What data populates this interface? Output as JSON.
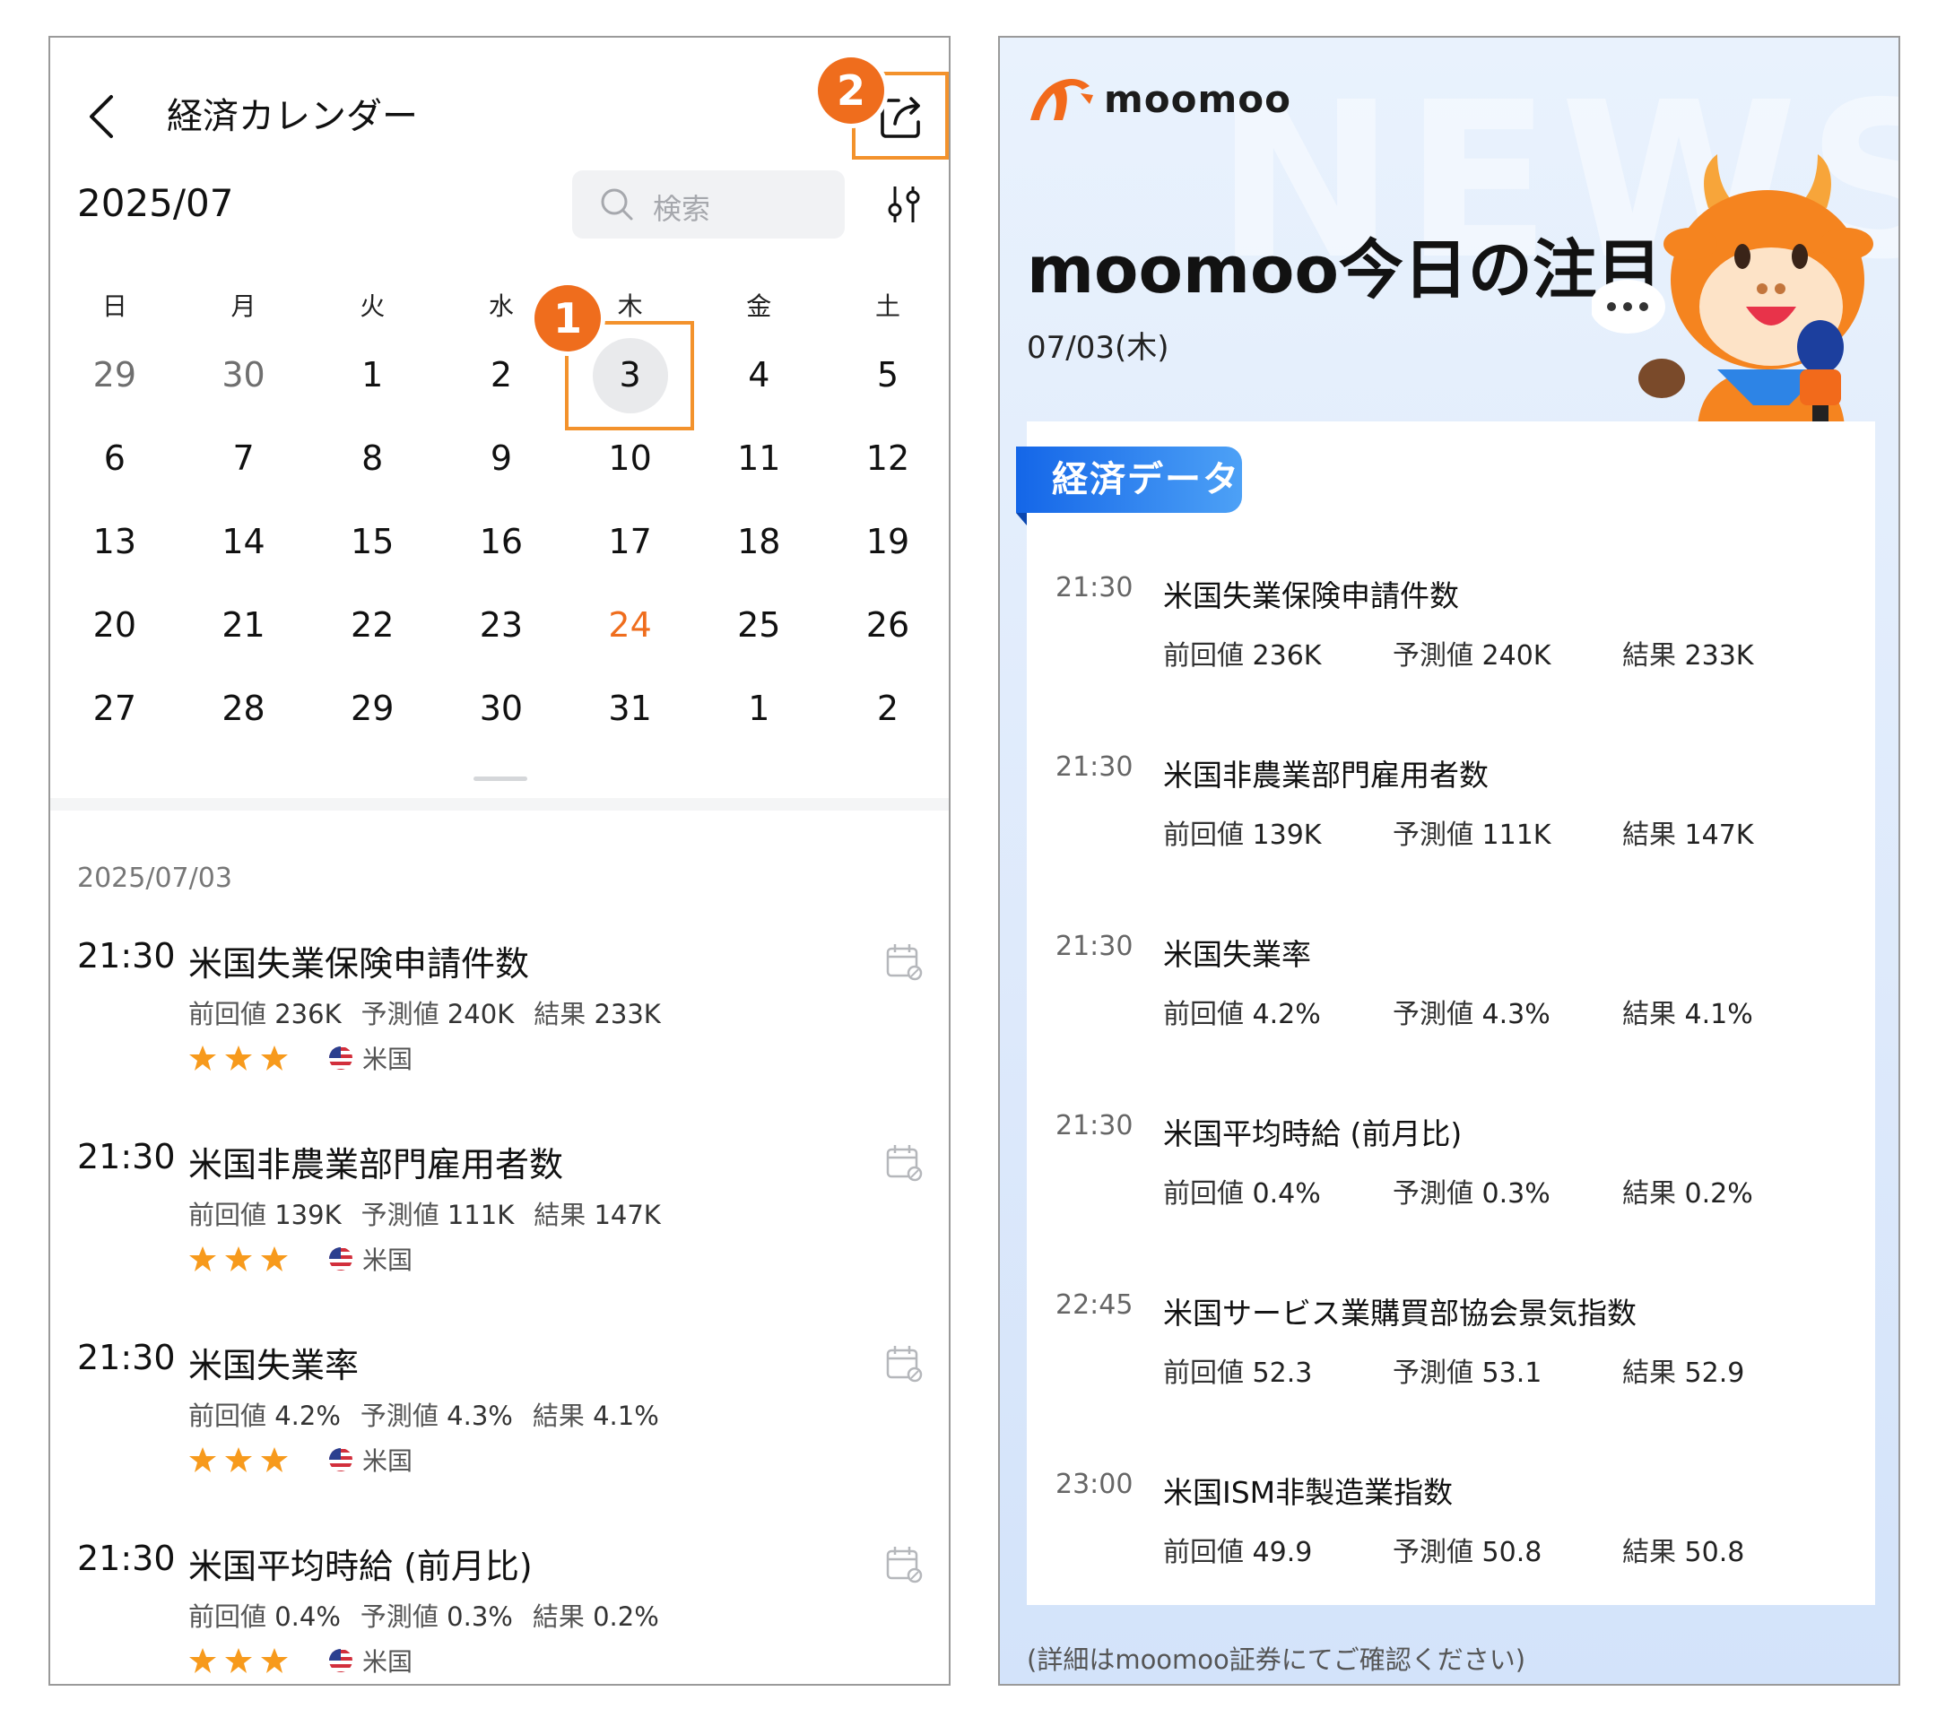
{
  "left": {
    "header": {
      "title": "経済カレンダー"
    },
    "badges": {
      "one": "1",
      "two": "2"
    },
    "month": "2025/07",
    "search": {
      "placeholder": "検索"
    },
    "weekdays": [
      "日",
      "月",
      "火",
      "水",
      "木",
      "金",
      "土"
    ],
    "weeks": [
      [
        "29",
        "30",
        "1",
        "2",
        "3",
        "4",
        "5"
      ],
      [
        "6",
        "7",
        "8",
        "9",
        "10",
        "11",
        "12"
      ],
      [
        "13",
        "14",
        "15",
        "16",
        "17",
        "18",
        "19"
      ],
      [
        "20",
        "21",
        "22",
        "23",
        "24",
        "25",
        "26"
      ],
      [
        "27",
        "28",
        "29",
        "30",
        "31",
        "1",
        "2"
      ]
    ],
    "list_date": "2025/07/03",
    "events": [
      {
        "time": "21:30",
        "name": "米国失業保険申請件数",
        "prev_label": "前回値",
        "prev": "236K",
        "fc_label": "予測値",
        "fc": "240K",
        "res_label": "結果",
        "res": "233K",
        "country": "米国"
      },
      {
        "time": "21:30",
        "name": "米国非農業部門雇用者数",
        "prev_label": "前回値",
        "prev": "139K",
        "fc_label": "予測値",
        "fc": "111K",
        "res_label": "結果",
        "res": "147K",
        "country": "米国"
      },
      {
        "time": "21:30",
        "name": "米国失業率",
        "prev_label": "前回値",
        "prev": "4.2%",
        "fc_label": "予測値",
        "fc": "4.3%",
        "res_label": "結果",
        "res": "4.1%",
        "country": "米国"
      },
      {
        "time": "21:30",
        "name": "米国平均時給 (前月比)",
        "prev_label": "前回値",
        "prev": "0.4%",
        "fc_label": "予測値",
        "fc": "0.3%",
        "res_label": "結果",
        "res": "0.2%",
        "country": "米国"
      }
    ]
  },
  "right": {
    "watermark": "NEWS",
    "logo_text": "moomoo",
    "title": "moomoo今日の注目",
    "date": "07/03(木)",
    "section_tag": "経済データ",
    "events": [
      {
        "time": "21:30",
        "name": "米国失業保険申請件数",
        "prev_label": "前回値",
        "prev": "236K",
        "fc_label": "予測値",
        "fc": "240K",
        "res_label": "結果",
        "res": "233K"
      },
      {
        "time": "21:30",
        "name": "米国非農業部門雇用者数",
        "prev_label": "前回値",
        "prev": "139K",
        "fc_label": "予測値",
        "fc": "111K",
        "res_label": "結果",
        "res": "147K"
      },
      {
        "time": "21:30",
        "name": "米国失業率",
        "prev_label": "前回値",
        "prev": "4.2%",
        "fc_label": "予測値",
        "fc": "4.3%",
        "res_label": "結果",
        "res": "4.1%"
      },
      {
        "time": "21:30",
        "name": "米国平均時給 (前月比)",
        "prev_label": "前回値",
        "prev": "0.4%",
        "fc_label": "予測値",
        "fc": "0.3%",
        "res_label": "結果",
        "res": "0.2%"
      },
      {
        "time": "22:45",
        "name": "米国サービス業購買部協会景気指数",
        "prev_label": "前回値",
        "prev": "52.3",
        "fc_label": "予測値",
        "fc": "53.1",
        "res_label": "結果",
        "res": "52.9"
      },
      {
        "time": "23:00",
        "name": "米国ISM非製造業指数",
        "prev_label": "前回値",
        "prev": "49.9",
        "fc_label": "予測値",
        "fc": "50.8",
        "res_label": "結果",
        "res": "50.8"
      }
    ],
    "footer_note": "(詳細はmoomoo証券にてご確認ください)"
  },
  "colors": {
    "accent_orange": "#ef6d1d",
    "highlight_box": "#f3922c",
    "tag_blue": "#1466e8",
    "star": "#f79a1c"
  },
  "icons": [
    "back-chevron-icon",
    "share-icon",
    "search-icon",
    "filter-sliders-icon",
    "calendar-reminder-icon",
    "star-icon",
    "us-flag-icon",
    "moomoo-logo-icon",
    "mascot-icon"
  ]
}
